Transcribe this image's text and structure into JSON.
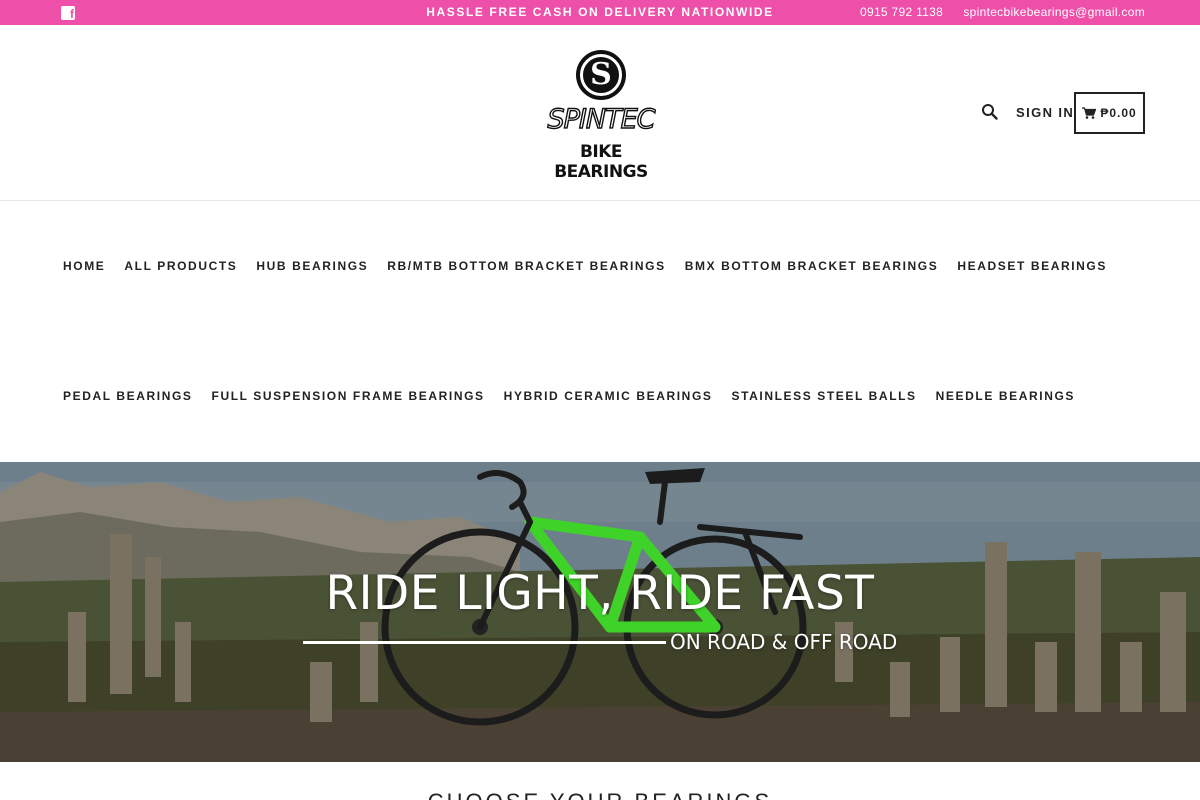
{
  "topbar": {
    "facebook_icon": "facebook-icon",
    "announcement": "HASSLE FREE CASH ON DELIVERY NATIONWIDE",
    "phone": "0915 792 1138",
    "email": "spintecbikebearings@gmail.com",
    "background": "#ee4fa8"
  },
  "header": {
    "logo_brand": "SPINTEC",
    "logo_sub": "BIKE BEARINGS",
    "search_icon": "search-icon",
    "signin_label": "SIGN IN",
    "cart_icon": "cart-icon",
    "cart_total": "₱0.00"
  },
  "nav": {
    "row1": [
      {
        "label": "HOME"
      },
      {
        "label": "ALL PRODUCTS"
      },
      {
        "label": "HUB BEARINGS"
      },
      {
        "label": "RB/MTB BOTTOM BRACKET BEARINGS"
      },
      {
        "label": "BMX BOTTOM BRACKET BEARINGS"
      },
      {
        "label": "HEADSET BEARINGS"
      }
    ],
    "row2": [
      {
        "label": "PEDAL BEARINGS"
      },
      {
        "label": "FULL SUSPENSION FRAME BEARINGS"
      },
      {
        "label": "HYBRID CERAMIC BEARINGS"
      },
      {
        "label": "STAINLESS STEEL BALLS"
      },
      {
        "label": "NEEDLE BEARINGS"
      }
    ]
  },
  "hero": {
    "title": "RIDE LIGHT, RIDE FAST",
    "subtitle": "ON ROAD & OFF ROAD",
    "bike_color": "#3fd32a"
  },
  "section": {
    "title": "CHOOSE YOUR BEARINGS"
  }
}
